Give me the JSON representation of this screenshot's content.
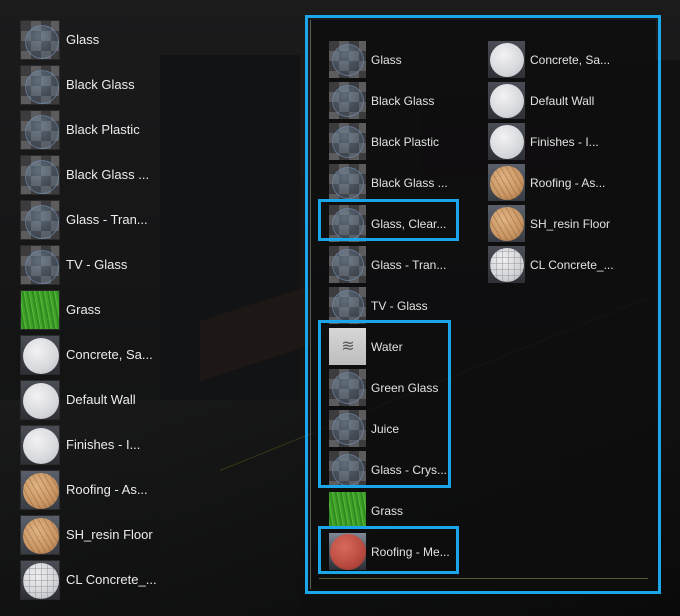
{
  "colors": {
    "highlight": "#1aa6e8",
    "text": "#ececec",
    "background": "#151516"
  },
  "left_list": {
    "items": [
      {
        "label": "Glass",
        "thumb": "glass"
      },
      {
        "label": "Black Glass",
        "thumb": "glass"
      },
      {
        "label": "Black Plastic",
        "thumb": "glass"
      },
      {
        "label": "Black Glass ...",
        "thumb": "glass"
      },
      {
        "label": "Glass - Tran...",
        "thumb": "glass"
      },
      {
        "label": "TV - Glass",
        "thumb": "glass"
      },
      {
        "label": "Grass",
        "thumb": "grass"
      },
      {
        "label": "Concrete, Sa...",
        "thumb": "white"
      },
      {
        "label": "Default Wall",
        "thumb": "white"
      },
      {
        "label": "Finishes - I...",
        "thumb": "white"
      },
      {
        "label": "Roofing - As...",
        "thumb": "wood"
      },
      {
        "label": "SH_resin Floor",
        "thumb": "wood"
      },
      {
        "label": "CL Concrete_...",
        "thumb": "tile"
      }
    ]
  },
  "panel": {
    "column_a": [
      {
        "label": "Glass",
        "thumb": "glass"
      },
      {
        "label": "Black Glass",
        "thumb": "glass"
      },
      {
        "label": "Black Plastic",
        "thumb": "glass"
      },
      {
        "label": "Black Glass ...",
        "thumb": "glass"
      },
      {
        "label": "Glass, Clear...",
        "thumb": "glass",
        "highlighted": true
      },
      {
        "label": "Glass - Tran...",
        "thumb": "glass"
      },
      {
        "label": "TV - Glass",
        "thumb": "glass"
      },
      {
        "label": "Water",
        "thumb": "water",
        "icon": "≋",
        "highlighted": true
      },
      {
        "label": "Green Glass",
        "thumb": "glass",
        "highlighted": true
      },
      {
        "label": "Juice",
        "thumb": "glass",
        "highlighted": true
      },
      {
        "label": "Glass - Crys...",
        "thumb": "glass",
        "highlighted": true
      },
      {
        "label": "Grass",
        "thumb": "grass"
      },
      {
        "label": "Roofing - Me...",
        "thumb": "red",
        "highlighted": true
      }
    ],
    "column_b": [
      {
        "label": "Concrete, Sa...",
        "thumb": "white"
      },
      {
        "label": "Default Wall",
        "thumb": "white"
      },
      {
        "label": "Finishes - I...",
        "thumb": "white"
      },
      {
        "label": "Roofing - As...",
        "thumb": "wood"
      },
      {
        "label": "SH_resin Floor",
        "thumb": "wood"
      },
      {
        "label": "CL Concrete_...",
        "thumb": "tile"
      }
    ]
  }
}
